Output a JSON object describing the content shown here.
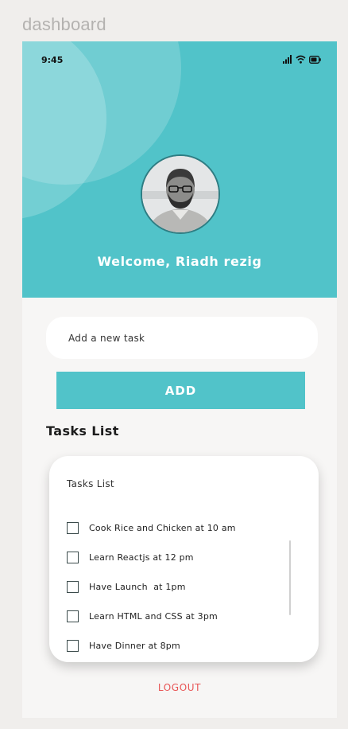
{
  "frame": {
    "label": "dashboard"
  },
  "status_bar": {
    "time": "9:45",
    "icons": [
      "signal-icon",
      "wifi-icon",
      "battery-icon"
    ]
  },
  "header": {
    "welcome": "Welcome, Riadh rezig",
    "colors": {
      "accent": "#51c3c9"
    }
  },
  "task_form": {
    "placeholder": "Add a new task",
    "value": "",
    "add_label": "ADD"
  },
  "tasks_section": {
    "title": "Tasks List",
    "card_title": "Tasks List",
    "items": [
      {
        "label": "Cook Rice and Chicken at 10 am",
        "checked": false
      },
      {
        "label": "Learn Reactjs at 12 pm",
        "checked": false
      },
      {
        "label": "Have Launch  at 1pm",
        "checked": false
      },
      {
        "label": "Learn HTML and CSS at 3pm",
        "checked": false
      },
      {
        "label": "Have Dinner at 8pm",
        "checked": false
      }
    ]
  },
  "footer": {
    "logout_label": "LOGOUT",
    "colors": {
      "logout": "#e85555"
    }
  }
}
